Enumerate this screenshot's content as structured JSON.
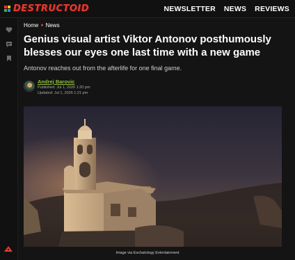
{
  "brand": {
    "logo_text": "DESTRUCTOID"
  },
  "nav": {
    "items": [
      "NEWSLETTER",
      "NEWS",
      "REVIEWS"
    ]
  },
  "breadcrumb": {
    "home": "Home",
    "section": "News"
  },
  "article": {
    "headline": "Genius visual artist Viktor Antonov posthumously blesses our eyes one last time with a new game",
    "subhead": "Antonov reaches out from the afterlife for one final game.",
    "author": "Andrej Barovic",
    "published": "Published: Jul 1, 2026 1:20 pm",
    "updated": "Updated: Jul 1, 2026 1:21 pm",
    "image_caption": "Image via Eschatology Entertainment"
  },
  "rail": {
    "icons": [
      "heart-icon",
      "comment-icon",
      "bookmark-icon"
    ]
  },
  "colors": {
    "accent": "#e63b2e",
    "author": "#8fbf3b",
    "background": "#141414"
  }
}
